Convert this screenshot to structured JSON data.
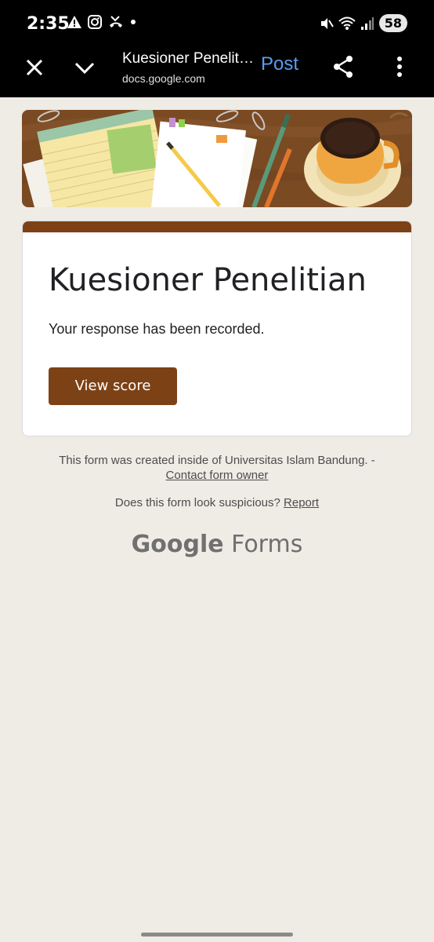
{
  "status_bar": {
    "time": "2:35",
    "battery": "58",
    "icons": [
      "warning-icon",
      "instagram-icon",
      "missed-call-icon",
      "dot-icon",
      "mute-icon",
      "wifi-icon",
      "signal-icon"
    ]
  },
  "toolbar": {
    "title": "Kuesioner Penelitian",
    "url": "docs.google.com",
    "post_label": "Post"
  },
  "form": {
    "title": "Kuesioner Penelitian",
    "message": "Your response has been recorded.",
    "view_score_label": "View score",
    "accent_color": "#7c4216"
  },
  "footer": {
    "created_text": "This form was created inside of Universitas Islam Bandung. -",
    "contact_link": "Contact form owner",
    "suspicious_text": "Does this form look suspicious?",
    "report_link": "Report",
    "brand_google": "Google",
    "brand_forms": "Forms"
  }
}
